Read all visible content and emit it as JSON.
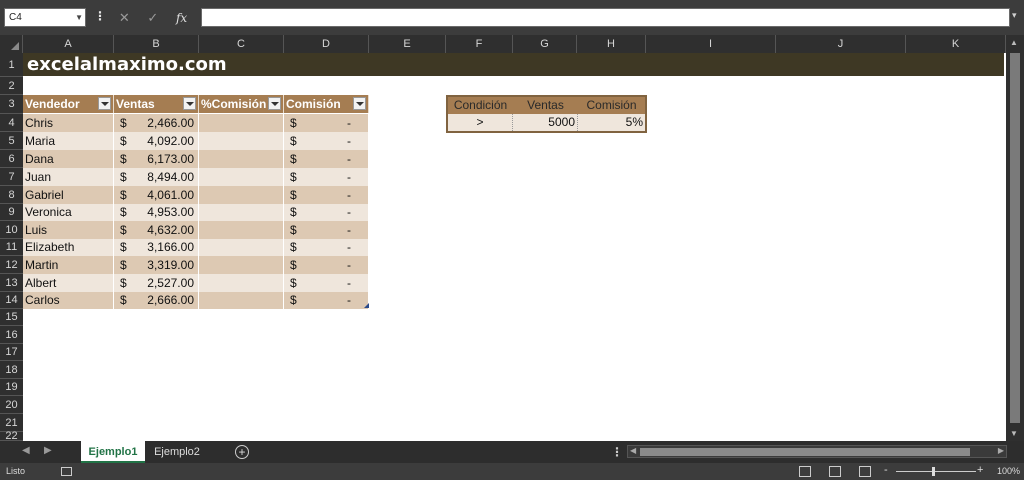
{
  "formula_bar": {
    "name_box": "C4",
    "fx_label": "fx",
    "formula": ""
  },
  "columns": [
    {
      "label": "A"
    },
    {
      "label": "B"
    },
    {
      "label": "C"
    },
    {
      "label": "D"
    },
    {
      "label": "E"
    },
    {
      "label": "F"
    },
    {
      "label": "G"
    },
    {
      "label": "H"
    },
    {
      "label": "I"
    },
    {
      "label": "J"
    },
    {
      "label": "K"
    }
  ],
  "rows": [
    "1",
    "2",
    "3",
    "4",
    "5",
    "6",
    "7",
    "8",
    "9",
    "10",
    "11",
    "12",
    "13",
    "14",
    "15",
    "16",
    "17",
    "18",
    "19",
    "20",
    "21",
    "22"
  ],
  "sheet_title": "excelalmaximo.com",
  "table": {
    "headers": [
      "Vendedor",
      "Ventas",
      "%Comisión",
      "Comisión"
    ],
    "currency": "$",
    "empty_value": "-",
    "rows": [
      {
        "name": "Chris",
        "ventas": "2,466.00"
      },
      {
        "name": "Maria",
        "ventas": "4,092.00"
      },
      {
        "name": "Dana",
        "ventas": "6,173.00"
      },
      {
        "name": "Juan",
        "ventas": "8,494.00"
      },
      {
        "name": "Gabriel",
        "ventas": "4,061.00"
      },
      {
        "name": "Veronica",
        "ventas": "4,953.00"
      },
      {
        "name": "Luis",
        "ventas": "4,632.00"
      },
      {
        "name": "Elizabeth",
        "ventas": "3,166.00"
      },
      {
        "name": "Martin",
        "ventas": "3,319.00"
      },
      {
        "name": "Albert",
        "ventas": "2,527.00"
      },
      {
        "name": "Carlos",
        "ventas": "2,666.00"
      }
    ]
  },
  "condition_table": {
    "headers": [
      "Condición",
      "Ventas",
      "Comisión"
    ],
    "values": [
      ">",
      "5000",
      "5%"
    ]
  },
  "tabs": {
    "active": "Ejemplo1",
    "other": "Ejemplo2",
    "add": "+"
  },
  "status": {
    "ready": "Listo",
    "zoom_minus": "-",
    "zoom_plus": "+",
    "zoom": "100%"
  },
  "colors": {
    "header": "#a57d52",
    "band_dark": "#ddc9b3",
    "band_light": "#efe6dc",
    "title_bg": "#3e3824",
    "accent": "#217346"
  }
}
